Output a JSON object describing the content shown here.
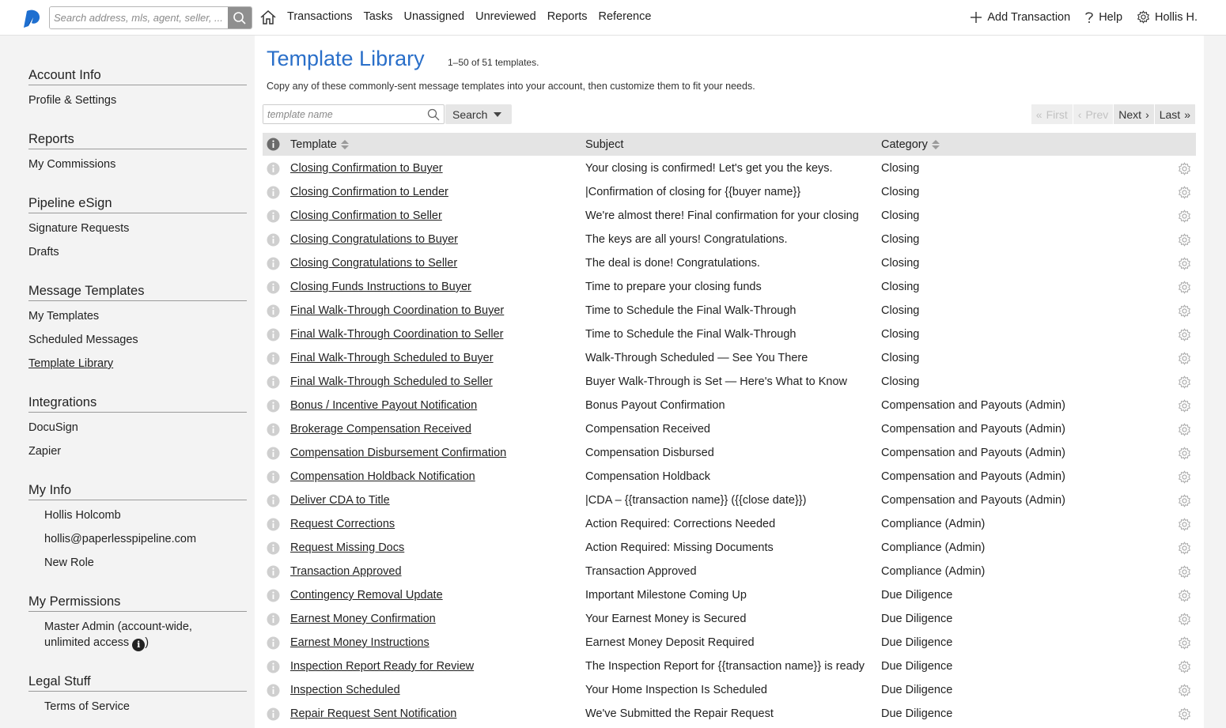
{
  "topbar": {
    "search_placeholder": "Search address, mls, agent, seller, ...",
    "nav": [
      "Transactions",
      "Tasks",
      "Unassigned",
      "Unreviewed",
      "Reports",
      "Reference"
    ],
    "add_transaction": "Add Transaction",
    "help": "Help",
    "user": "Hollis H."
  },
  "sidebar": {
    "sections": [
      {
        "title": "Account Info",
        "links": [
          "Profile & Settings"
        ]
      },
      {
        "title": "Reports",
        "links": [
          "My Commissions"
        ]
      },
      {
        "title": "Pipeline eSign",
        "links": [
          "Signature Requests",
          "Drafts"
        ]
      },
      {
        "title": "Message Templates",
        "links": [
          "My Templates",
          "Scheduled Messages",
          "Template Library"
        ]
      },
      {
        "title": "Integrations",
        "links": [
          "DocuSign",
          "Zapier"
        ]
      },
      {
        "title": "My Info",
        "links": [
          "Hollis Holcomb",
          "hollis@paperlesspipeline.com",
          "New Role"
        ]
      },
      {
        "title": "My Permissions",
        "links": [
          "Master Admin (account-wide,",
          "unlimited access"
        ]
      },
      {
        "title": "Legal Stuff",
        "links": [
          "Terms of Service"
        ]
      }
    ],
    "permissions_suffix": ")"
  },
  "main": {
    "title": "Template Library",
    "count": "1–50 of 51 templates.",
    "description": "Copy any of these commonly-sent message templates into your account, then customize them to fit your needs.",
    "search_placeholder": "template name",
    "search_button": "Search",
    "pager": {
      "first": "First",
      "prev": "Prev",
      "next": "Next",
      "last": "Last"
    },
    "columns": {
      "template": "Template",
      "subject": "Subject",
      "category": "Category"
    },
    "rows": [
      {
        "template": "Closing Confirmation to Buyer",
        "subject": "Your closing is confirmed! Let's get you the keys.",
        "category": "Closing"
      },
      {
        "template": "Closing Confirmation to Lender",
        "subject": "|Confirmation of closing for {{buyer name}}",
        "category": "Closing"
      },
      {
        "template": "Closing Confirmation to Seller",
        "subject": "We're almost there! Final confirmation for your closing",
        "category": "Closing"
      },
      {
        "template": "Closing Congratulations to Buyer",
        "subject": "The keys are all yours! Congratulations.",
        "category": "Closing"
      },
      {
        "template": "Closing Congratulations to Seller",
        "subject": "The deal is done! Congratulations.",
        "category": "Closing"
      },
      {
        "template": "Closing Funds Instructions to Buyer",
        "subject": "Time to prepare your closing funds",
        "category": "Closing"
      },
      {
        "template": "Final Walk-Through Coordination to Buyer",
        "subject": "Time to Schedule the Final Walk-Through",
        "category": "Closing"
      },
      {
        "template": "Final Walk-Through Coordination to Seller",
        "subject": "Time to Schedule the Final Walk-Through",
        "category": "Closing"
      },
      {
        "template": "Final Walk-Through Scheduled to Buyer",
        "subject": "Walk-Through Scheduled — See You There",
        "category": "Closing"
      },
      {
        "template": "Final Walk-Through Scheduled to Seller",
        "subject": "Buyer Walk-Through is Set — Here's What to Know",
        "category": "Closing"
      },
      {
        "template": "Bonus / Incentive Payout Notification",
        "subject": "Bonus Payout Confirmation",
        "category": "Compensation and Payouts (Admin)"
      },
      {
        "template": "Brokerage Compensation Received",
        "subject": "Compensation Received",
        "category": "Compensation and Payouts (Admin)"
      },
      {
        "template": "Compensation Disbursement Confirmation",
        "subject": "Compensation Disbursed",
        "category": "Compensation and Payouts (Admin)"
      },
      {
        "template": "Compensation Holdback Notification",
        "subject": "Compensation Holdback",
        "category": "Compensation and Payouts (Admin)"
      },
      {
        "template": "Deliver CDA to Title",
        "subject": "|CDA – {{transaction name}} ({{close date}})",
        "category": "Compensation and Payouts (Admin)"
      },
      {
        "template": "Request Corrections",
        "subject": "Action Required: Corrections Needed",
        "category": "Compliance (Admin)"
      },
      {
        "template": "Request Missing Docs",
        "subject": "Action Required: Missing Documents",
        "category": "Compliance (Admin)"
      },
      {
        "template": "Transaction Approved",
        "subject": "Transaction Approved",
        "category": "Compliance (Admin)"
      },
      {
        "template": "Contingency Removal Update",
        "subject": "Important Milestone Coming Up",
        "category": "Due Diligence"
      },
      {
        "template": "Earnest Money Confirmation",
        "subject": "Your Earnest Money is Secured",
        "category": "Due Diligence"
      },
      {
        "template": "Earnest Money Instructions",
        "subject": "Earnest Money Deposit Required",
        "category": "Due Diligence"
      },
      {
        "template": "Inspection Report Ready for Review",
        "subject": "The Inspection Report for {{transaction name}} is ready",
        "category": "Due Diligence"
      },
      {
        "template": "Inspection Scheduled",
        "subject": "Your Home Inspection Is Scheduled",
        "category": "Due Diligence"
      },
      {
        "template": "Repair Request Sent Notification",
        "subject": "We've Submitted the Repair Request",
        "category": "Due Diligence"
      }
    ]
  },
  "colors": {
    "accent": "#2a6fc9",
    "sidebar_bg": "#f3f3f3",
    "header_bg": "#e4e4e4"
  }
}
